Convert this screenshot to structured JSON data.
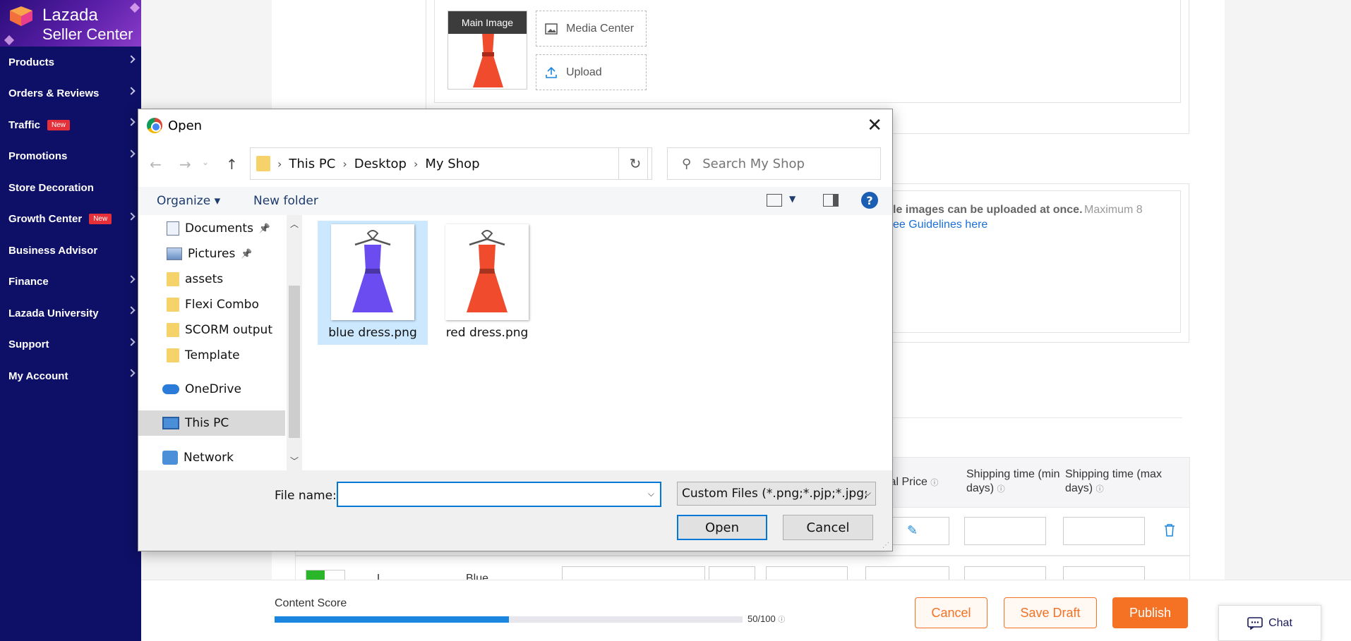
{
  "sidebar": {
    "brand": "Lazada",
    "brand_sub": "Seller Center",
    "items": [
      {
        "label": "Products",
        "badge": null,
        "chevron": true
      },
      {
        "label": "Orders & Reviews",
        "badge": null,
        "chevron": true
      },
      {
        "label": "Traffic",
        "badge": "New",
        "chevron": true
      },
      {
        "label": "Promotions",
        "badge": null,
        "chevron": true
      },
      {
        "label": "Store Decoration",
        "badge": null,
        "chevron": false
      },
      {
        "label": "Growth Center",
        "badge": "New",
        "chevron": true
      },
      {
        "label": "Business Advisor",
        "badge": null,
        "chevron": false
      },
      {
        "label": "Finance",
        "badge": null,
        "chevron": true
      },
      {
        "label": "Lazada University",
        "badge": null,
        "chevron": true
      },
      {
        "label": "Support",
        "badge": null,
        "chevron": true
      },
      {
        "label": "My Account",
        "badge": null,
        "chevron": true
      }
    ]
  },
  "background": {
    "main_image_tag": "Main Image",
    "media_center": "Media Center",
    "upload": "Upload",
    "images_note": "le images can be uploaded at once.",
    "images_max": "Maximum 8",
    "guidelines": "ee Guidelines here",
    "col_price": "ial Price",
    "col_ship_min": "Shipping time (min days)",
    "col_ship_max": "Shipping time (max days)",
    "row2_variant": "Blue",
    "row2_size": "L"
  },
  "bottom": {
    "content_score_label": "Content Score",
    "content_score_value": "50/100",
    "content_score_fraction": 0.5,
    "cancel": "Cancel",
    "save_draft": "Save Draft",
    "publish": "Publish",
    "chat": "Chat"
  },
  "colors": {
    "sidebar_bg": "#0e1067",
    "publish_bg": "#f57224",
    "accent_orange": "#f57224",
    "progress_blue": "#1a86df",
    "dialog_focus": "#0078d7"
  },
  "dialog": {
    "title": "Open",
    "close": "✕",
    "breadcrumb": [
      "This PC",
      "Desktop",
      "My Shop"
    ],
    "search_placeholder": "Search My Shop",
    "organize": "Organize",
    "new_folder": "New folder",
    "help": "?",
    "tree": [
      {
        "label": "Documents",
        "icon": "documents-icon",
        "pinned": true
      },
      {
        "label": "Pictures",
        "icon": "pictures-icon",
        "pinned": true
      },
      {
        "label": "assets",
        "icon": "folder-icon",
        "pinned": false
      },
      {
        "label": "Flexi Combo",
        "icon": "folder-icon",
        "pinned": false
      },
      {
        "label": "SCORM output",
        "icon": "folder-icon",
        "pinned": false
      },
      {
        "label": "Template",
        "icon": "folder-icon",
        "pinned": false
      },
      {
        "label": "OneDrive",
        "icon": "onedrive-icon",
        "pinned": false
      },
      {
        "label": "This PC",
        "icon": "this-pc-icon",
        "pinned": false,
        "selected": true
      },
      {
        "label": "Network",
        "icon": "network-icon",
        "pinned": false
      }
    ],
    "files": [
      {
        "name": "blue dress.png",
        "color": "#6b4cf0",
        "selected": true
      },
      {
        "name": "red dress.png",
        "color": "#ef4b2c",
        "selected": false
      }
    ],
    "file_name_label": "File name:",
    "file_name_value": "",
    "file_type": "Custom Files (*.png;*.pjp;*.jpg;",
    "open_button": "Open",
    "cancel_button": "Cancel"
  }
}
